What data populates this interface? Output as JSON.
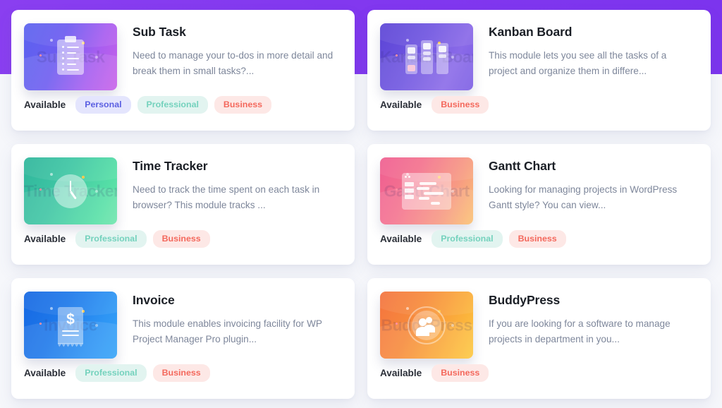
{
  "theme": {
    "banner_color": "#8238ef",
    "page_background": "#f6f7fb",
    "card_background": "#ffffff",
    "title_color": "#1b1f26",
    "description_color": "#7e879b",
    "available_label_color": "#2b2f38",
    "pill_personal_bg": "#e4e5fd",
    "pill_personal_text": "#5b5fe2",
    "pill_professional_bg": "#e2f4f0",
    "pill_professional_text": "#74d2bd",
    "pill_business_bg": "#fde8e6",
    "pill_business_text": "#f4685c"
  },
  "availability_label": "Available",
  "modules": [
    {
      "title": "Sub Task",
      "description": "Need to manage your to-dos in more detail and break them in small tasks?...",
      "watermark": "Sub Task",
      "icon": "clipboard-checklist-icon",
      "thumb_gradient": "g-subtask",
      "plans": [
        {
          "label": "Personal",
          "style": "pill-personal"
        },
        {
          "label": "Professional",
          "style": "pill-professional"
        },
        {
          "label": "Business",
          "style": "pill-business"
        }
      ]
    },
    {
      "title": "Kanban Board",
      "description": "This module lets you see all the tasks of a project and organize them in differe...",
      "watermark": "Kanban Board",
      "icon": "kanban-columns-icon",
      "thumb_gradient": "g-kanban",
      "plans": [
        {
          "label": "Business",
          "style": "pill-business"
        }
      ]
    },
    {
      "title": "Time Tracker",
      "description": "Need to track the time spent on each task in browser? This module tracks ...",
      "watermark": "Time Tracker",
      "icon": "clock-icon",
      "thumb_gradient": "g-time",
      "plans": [
        {
          "label": "Professional",
          "style": "pill-professional"
        },
        {
          "label": "Business",
          "style": "pill-business"
        }
      ]
    },
    {
      "title": "Gantt Chart",
      "description": "Looking for managing projects in WordPress Gantt style? You can view...",
      "watermark": "Gantt Chart",
      "icon": "gantt-window-icon",
      "thumb_gradient": "g-gantt",
      "plans": [
        {
          "label": "Professional",
          "style": "pill-professional"
        },
        {
          "label": "Business",
          "style": "pill-business"
        }
      ]
    },
    {
      "title": "Invoice",
      "description": "This module enables invoicing facility for WP Project Manager Pro plugin...",
      "watermark": "Invoice",
      "icon": "invoice-receipt-icon",
      "thumb_gradient": "g-invoice",
      "currency_symbol": "$",
      "plans": [
        {
          "label": "Professional",
          "style": "pill-professional"
        },
        {
          "label": "Business",
          "style": "pill-business"
        }
      ]
    },
    {
      "title": "BuddyPress",
      "description": "If you are looking for a software to manage projects in department in you...",
      "watermark": "BuddyPress",
      "icon": "users-group-icon",
      "thumb_gradient": "g-buddy",
      "plans": [
        {
          "label": "Business",
          "style": "pill-business"
        }
      ]
    }
  ]
}
